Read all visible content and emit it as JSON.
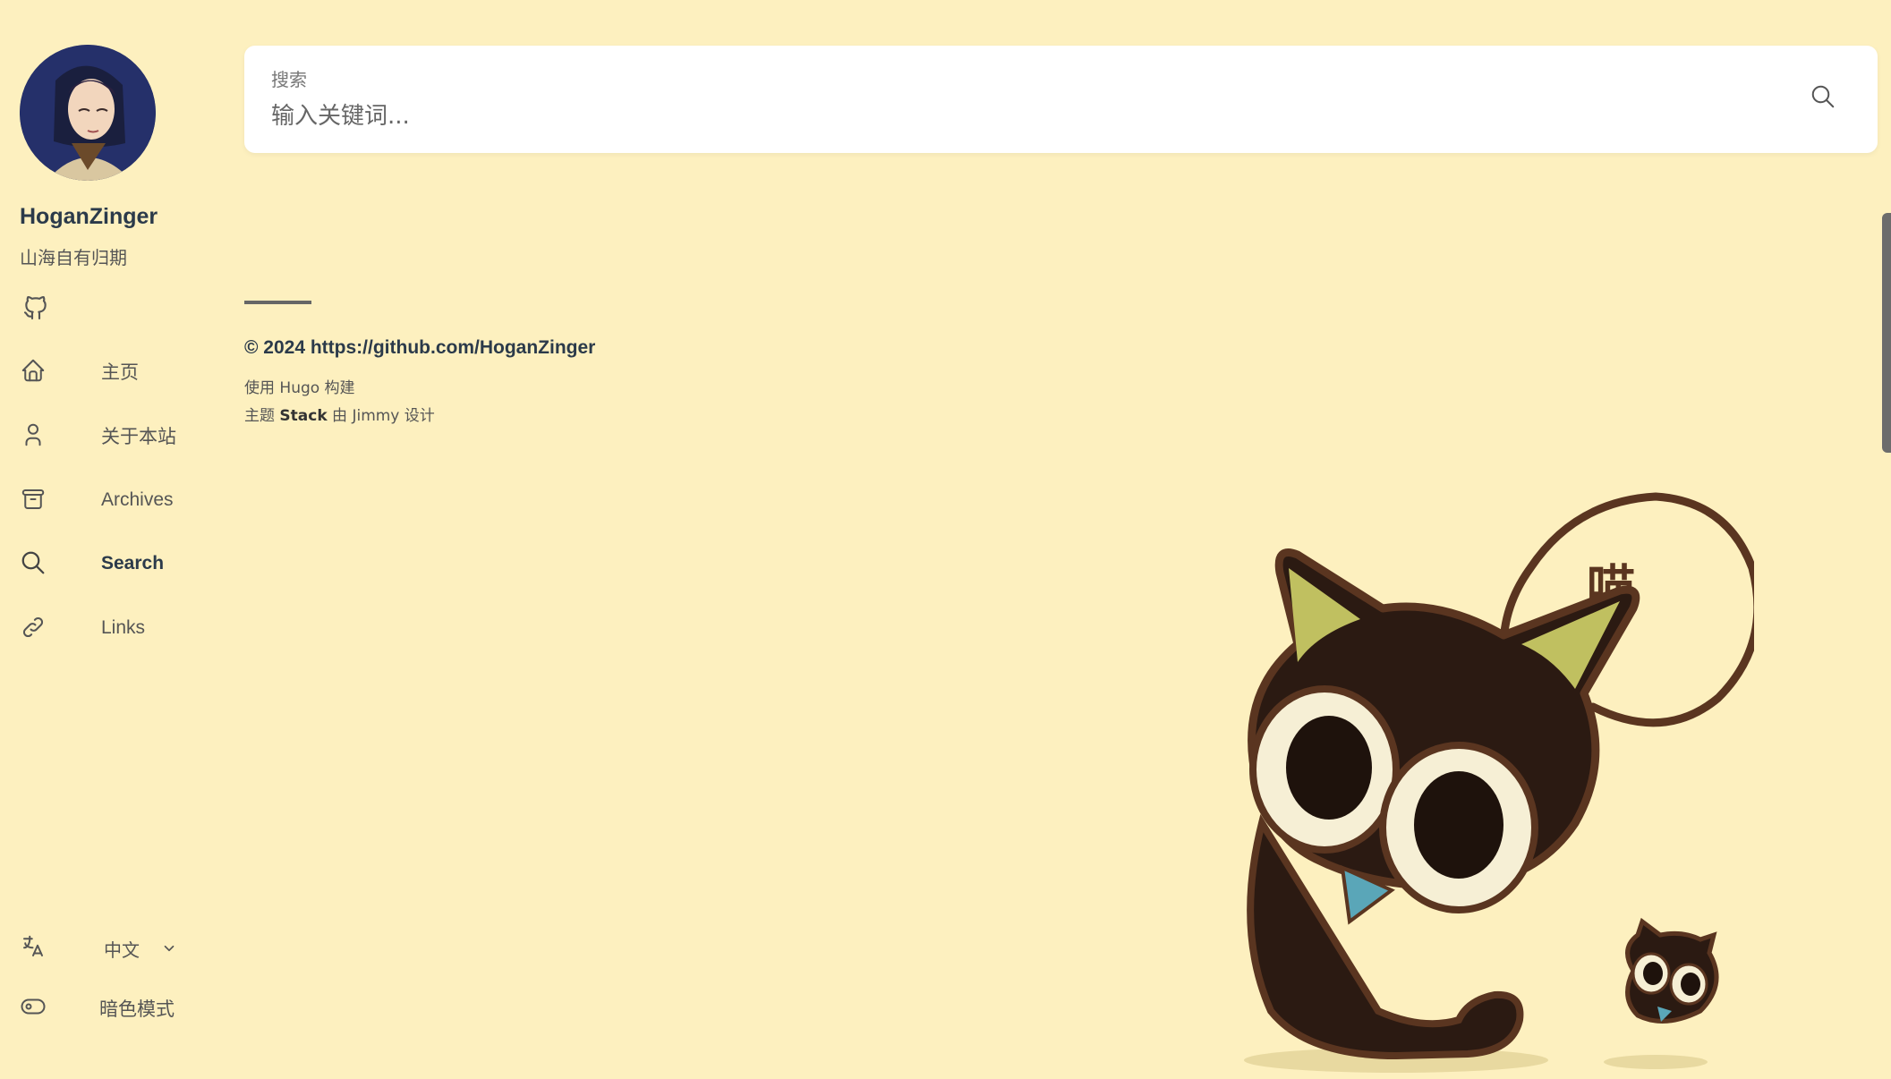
{
  "sidebar": {
    "site_name": "HoganZinger",
    "site_description": "山海自有归期",
    "menu": [
      {
        "label": "主页",
        "icon": "home-icon"
      },
      {
        "label": "关于本站",
        "icon": "user-icon"
      },
      {
        "label": "Archives",
        "icon": "archive-icon"
      },
      {
        "label": "Search",
        "icon": "search-icon",
        "active": true
      },
      {
        "label": "Links",
        "icon": "link-icon"
      }
    ],
    "language": {
      "selected": "中文",
      "icon": "language-icon"
    },
    "dark_mode_label": "暗色模式",
    "social": [
      {
        "icon": "github-icon"
      }
    ]
  },
  "search": {
    "label": "搜索",
    "placeholder": "输入关键词...",
    "value": ""
  },
  "footer": {
    "copyright": "© 2024 https://github.com/HoganZinger",
    "built_prefix": "使用 ",
    "built_link": "Hugo",
    "built_suffix": " 构建",
    "theme_prefix": "主题 ",
    "theme_name": "Stack",
    "theme_middle": " 由 ",
    "theme_author": "Jimmy",
    "theme_suffix": " 设计"
  },
  "decoration": {
    "speech_bubble_text": "喵"
  },
  "colors": {
    "background": "#fdf0bf",
    "card": "#ffffff",
    "accent": "#2b3a4a"
  }
}
